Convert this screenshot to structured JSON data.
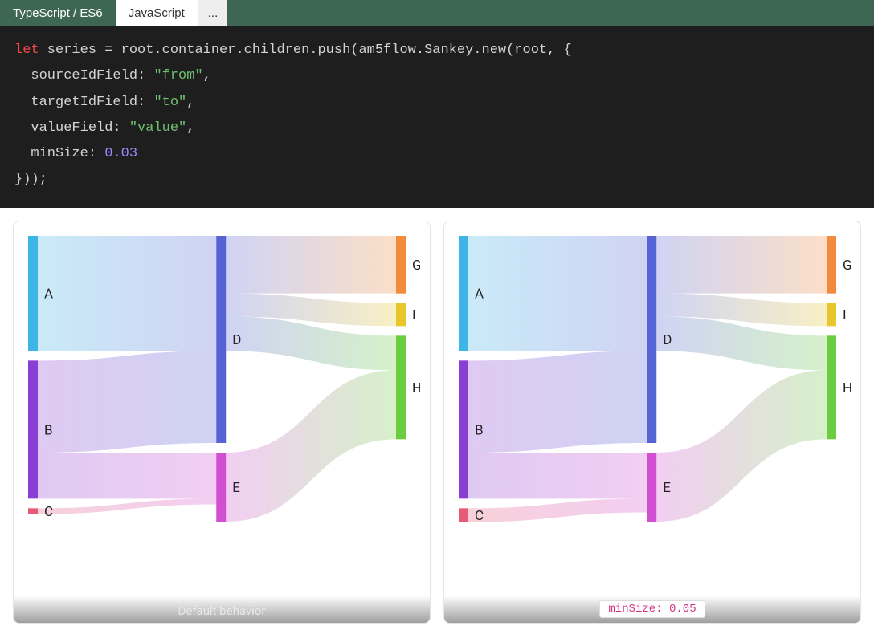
{
  "tabs": {
    "ts": "TypeScript / ES6",
    "js": "JavaScript",
    "more": "..."
  },
  "code": "let series = root.container.children.push(am5flow.Sankey.new(root, {\n  sourceIdField: \"from\",\n  targetIdField: \"to\",\n  valueField: \"value\",\n  minSize: 0.03\n}));",
  "captions": {
    "left": "Default behavior",
    "right": "minSize: 0.05"
  },
  "chart_data": [
    {
      "type": "sankey",
      "title": "Default behavior",
      "nodes": [
        {
          "id": "A",
          "color": "#3fb4e6"
        },
        {
          "id": "B",
          "color": "#8a3fd4"
        },
        {
          "id": "C",
          "color": "#e65a78"
        },
        {
          "id": "D",
          "color": "#5563d4"
        },
        {
          "id": "E",
          "color": "#d24fd1"
        },
        {
          "id": "G",
          "color": "#f28b3b"
        },
        {
          "id": "H",
          "color": "#6bcc3f"
        },
        {
          "id": "I",
          "color": "#e8c72d"
        }
      ],
      "links": [
        {
          "from": "A",
          "to": "D",
          "value": 10
        },
        {
          "from": "B",
          "to": "D",
          "value": 8
        },
        {
          "from": "B",
          "to": "E",
          "value": 4
        },
        {
          "from": "C",
          "to": "E",
          "value": 0.5
        },
        {
          "from": "D",
          "to": "G",
          "value": 5
        },
        {
          "from": "D",
          "to": "I",
          "value": 2
        },
        {
          "from": "D",
          "to": "H",
          "value": 3
        },
        {
          "from": "E",
          "to": "H",
          "value": 6
        }
      ]
    },
    {
      "type": "sankey",
      "title": "minSize: 0.05",
      "minSize": 0.05,
      "nodes": [
        {
          "id": "A",
          "color": "#3fb4e6"
        },
        {
          "id": "B",
          "color": "#8a3fd4"
        },
        {
          "id": "C",
          "color": "#e65a78"
        },
        {
          "id": "D",
          "color": "#5563d4"
        },
        {
          "id": "E",
          "color": "#d24fd1"
        },
        {
          "id": "G",
          "color": "#f28b3b"
        },
        {
          "id": "H",
          "color": "#6bcc3f"
        },
        {
          "id": "I",
          "color": "#e8c72d"
        }
      ],
      "links": [
        {
          "from": "A",
          "to": "D",
          "value": 10
        },
        {
          "from": "B",
          "to": "D",
          "value": 8
        },
        {
          "from": "B",
          "to": "E",
          "value": 4
        },
        {
          "from": "C",
          "to": "E",
          "value": 1.2
        },
        {
          "from": "D",
          "to": "G",
          "value": 5
        },
        {
          "from": "D",
          "to": "I",
          "value": 2
        },
        {
          "from": "D",
          "to": "H",
          "value": 3
        },
        {
          "from": "E",
          "to": "H",
          "value": 6
        }
      ]
    }
  ]
}
